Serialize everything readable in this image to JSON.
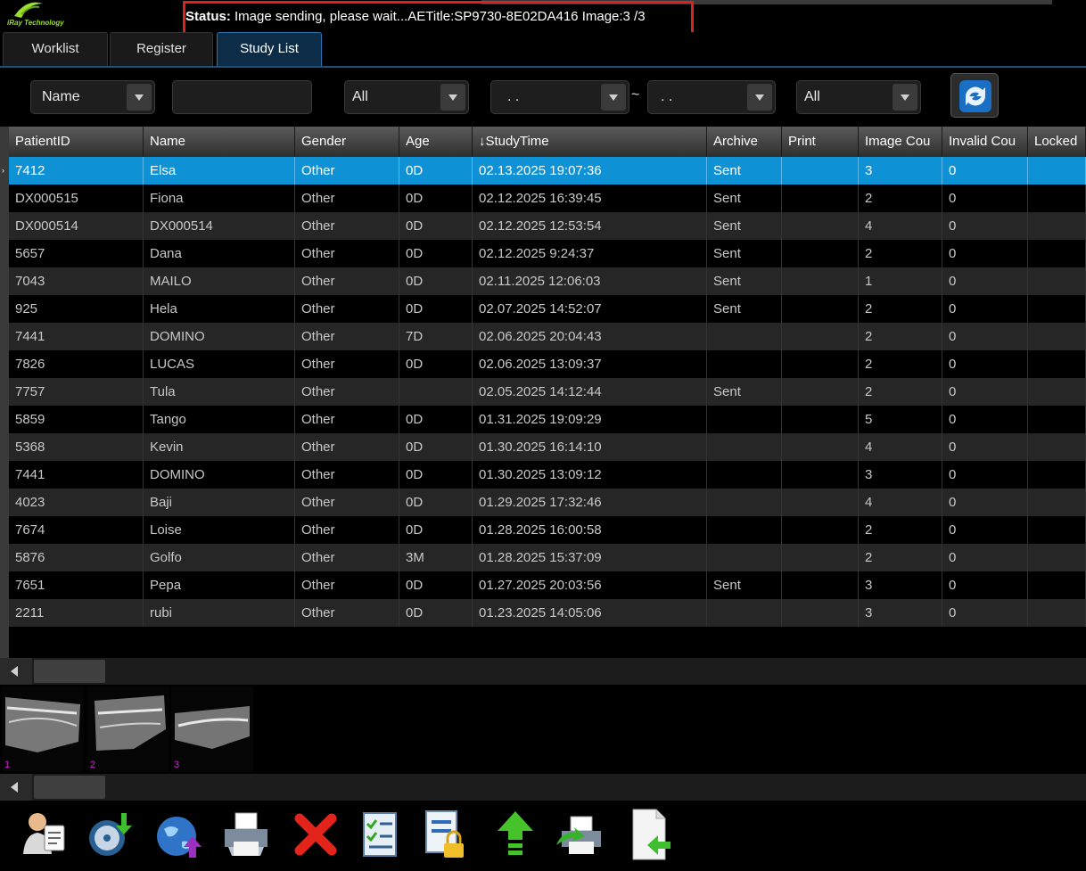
{
  "header": {
    "logo_text": "iRay Technology",
    "status_label": "Status:",
    "status_message": " Image sending, please wait...AETitle:SP9730-8E02DA416 Image:3 /3"
  },
  "tabs": [
    {
      "label": "Worklist",
      "active": false
    },
    {
      "label": "Register",
      "active": false
    },
    {
      "label": "Study List",
      "active": true
    }
  ],
  "filters": {
    "field_select": "Name",
    "search_value": "",
    "gender_select": "All",
    "date_from": ". .",
    "date_separator": "~",
    "date_to": ". .",
    "status_select": "All"
  },
  "table": {
    "columns": [
      "PatientID",
      "Name",
      "Gender",
      "Age",
      "↓StudyTime",
      "Archive",
      "Print",
      "Image Cou",
      "Invalid Cou",
      "Locked"
    ],
    "rows": [
      [
        "7412",
        "Elsa",
        "Other",
        "0D",
        "02.13.2025 19:07:36",
        "Sent",
        "",
        "3",
        "0",
        ""
      ],
      [
        "DX000515",
        "Fiona",
        "Other",
        "0D",
        "02.12.2025 16:39:45",
        "Sent",
        "",
        "2",
        "0",
        ""
      ],
      [
        "DX000514",
        "DX000514",
        "Other",
        "0D",
        "02.12.2025 12:53:54",
        "Sent",
        "",
        "4",
        "0",
        ""
      ],
      [
        "5657",
        "Dana",
        "Other",
        "0D",
        "02.12.2025 9:24:37",
        "Sent",
        "",
        "2",
        "0",
        ""
      ],
      [
        "7043",
        "MAILO",
        "Other",
        "0D",
        "02.11.2025 12:06:03",
        "Sent",
        "",
        "1",
        "0",
        ""
      ],
      [
        "925",
        "Hela",
        "Other",
        "0D",
        "02.07.2025 14:52:07",
        "Sent",
        "",
        "2",
        "0",
        ""
      ],
      [
        "7441",
        "DOMINO",
        "Other",
        "7D",
        "02.06.2025 20:04:43",
        "",
        "",
        "2",
        "0",
        ""
      ],
      [
        "7826",
        "LUCAS",
        "Other",
        "0D",
        "02.06.2025 13:09:37",
        "",
        "",
        "2",
        "0",
        ""
      ],
      [
        "7757",
        "Tula",
        "Other",
        "",
        "02.05.2025 14:12:44",
        "Sent",
        "",
        "2",
        "0",
        ""
      ],
      [
        "5859",
        "Tango",
        "Other",
        "0D",
        "01.31.2025 19:09:29",
        "",
        "",
        "5",
        "0",
        ""
      ],
      [
        "5368",
        "Kevin",
        "Other",
        "0D",
        "01.30.2025 16:14:10",
        "",
        "",
        "4",
        "0",
        ""
      ],
      [
        "7441",
        "DOMINO",
        "Other",
        "0D",
        "01.30.2025 13:09:12",
        "",
        "",
        "3",
        "0",
        ""
      ],
      [
        "4023",
        "Baji",
        "Other",
        "0D",
        "01.29.2025 17:32:46",
        "",
        "",
        "4",
        "0",
        ""
      ],
      [
        "7674",
        "Loise",
        "Other",
        "0D",
        "01.28.2025 16:00:58",
        "",
        "",
        "2",
        "0",
        ""
      ],
      [
        "5876",
        "Golfo",
        "Other",
        "3M",
        "01.28.2025 15:37:09",
        "",
        "",
        "2",
        "0",
        ""
      ],
      [
        "7651",
        "Pepa",
        "Other",
        "0D",
        "01.27.2025 20:03:56",
        "Sent",
        "",
        "3",
        "0",
        ""
      ],
      [
        "2211",
        "rubi",
        "Other",
        "0D",
        "01.23.2025 14:05:06",
        "",
        "",
        "3",
        "0",
        ""
      ]
    ],
    "selected_row": 0
  },
  "thumbnails": [
    {
      "number": "1"
    },
    {
      "number": "2"
    },
    {
      "number": "3"
    }
  ],
  "toolbar": [
    {
      "icon": "patient-report-icon"
    },
    {
      "icon": "cd-burn-icon"
    },
    {
      "icon": "globe-upload-icon"
    },
    {
      "icon": "printer-icon"
    },
    {
      "icon": "delete-icon"
    },
    {
      "icon": "checklist-icon"
    },
    {
      "icon": "lock-document-icon"
    },
    {
      "icon": "up-arrow-icon"
    },
    {
      "icon": "print-send-icon"
    },
    {
      "icon": "import-file-icon"
    }
  ],
  "colors": {
    "selection": "#0f91d6",
    "status_highlight": "#e0201c",
    "thumbnail_number": "#d326d3"
  }
}
